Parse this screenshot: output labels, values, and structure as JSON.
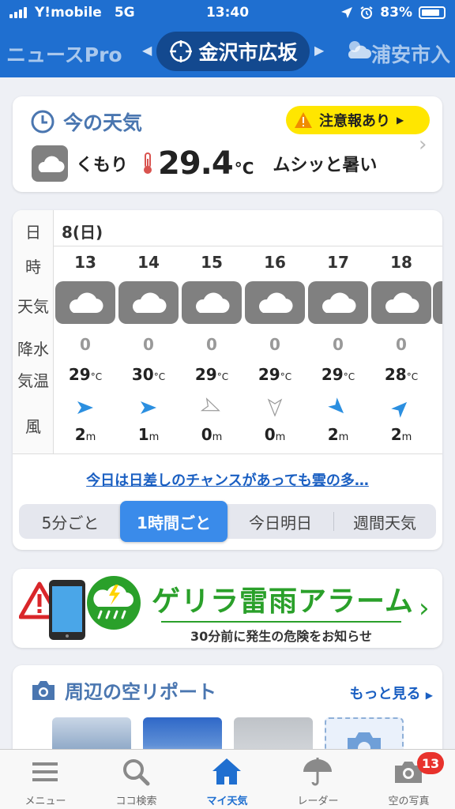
{
  "status_bar": {
    "carrier": "Y!mobile",
    "network": "5G",
    "time": "13:40",
    "battery": "83%"
  },
  "nav": {
    "prev_location": "ニュースPro",
    "current_location": "金沢市広坂",
    "next_location": "浦安市入"
  },
  "current_weather": {
    "title": "今の天気",
    "alert_badge": "注意報あり",
    "condition": "くもり",
    "temperature": "29.4",
    "temp_unit": "°C",
    "feels": "ムシッと暑い",
    "icon": "cloud-icon"
  },
  "hourly": {
    "labels": {
      "day": "日",
      "hour": "時",
      "weather": "天気",
      "rain": "降水",
      "temp": "気温",
      "wind": "風"
    },
    "day": "8(日)",
    "hours": [
      {
        "hour": "13",
        "rain": "0",
        "temp": "29",
        "temp_unit": "°C",
        "wind_speed": "2",
        "wind_unit": "m",
        "wind_dir": "east",
        "icon": "cloud-icon"
      },
      {
        "hour": "14",
        "rain": "0",
        "temp": "30",
        "temp_unit": "°C",
        "wind_speed": "1",
        "wind_unit": "m",
        "wind_dir": "east",
        "icon": "cloud-icon"
      },
      {
        "hour": "15",
        "rain": "0",
        "temp": "29",
        "temp_unit": "°C",
        "wind_speed": "0",
        "wind_unit": "m",
        "wind_dir": "east-southeast",
        "icon": "cloud-icon"
      },
      {
        "hour": "16",
        "rain": "0",
        "temp": "29",
        "temp_unit": "°C",
        "wind_speed": "0",
        "wind_unit": "m",
        "wind_dir": "south",
        "icon": "cloud-icon"
      },
      {
        "hour": "17",
        "rain": "0",
        "temp": "29",
        "temp_unit": "°C",
        "wind_speed": "2",
        "wind_unit": "m",
        "wind_dir": "south-east",
        "icon": "cloud-icon"
      },
      {
        "hour": "18",
        "rain": "0",
        "temp": "28",
        "temp_unit": "°C",
        "wind_speed": "2",
        "wind_unit": "m",
        "wind_dir": "north-east",
        "icon": "cloud-icon"
      }
    ],
    "news_link": "今日は日差しのチャンスがあっても雲の多…",
    "segments": [
      "5分ごと",
      "1時間ごと",
      "今日明日",
      "週間天気"
    ],
    "active_segment": "1時間ごと"
  },
  "alarm_banner": {
    "title": "ゲリラ雷雨アラーム",
    "subtitle": "30分前に発生の危険をお知らせ"
  },
  "sky_report": {
    "title": "周辺の空リポート",
    "more": "もっと見る"
  },
  "tabbar": {
    "items": [
      {
        "label": "メニュー",
        "icon": "menu-icon"
      },
      {
        "label": "ココ検索",
        "icon": "search-icon"
      },
      {
        "label": "マイ天気",
        "icon": "home-icon"
      },
      {
        "label": "レーダー",
        "icon": "umbrella-icon"
      },
      {
        "label": "空の写真",
        "icon": "camera-icon"
      }
    ],
    "active": "マイ天気",
    "photo_badge": "13"
  },
  "colors": {
    "header": "#1f6fd0",
    "accent_blue": "#1a5fc2",
    "alert_yellow": "#ffe600",
    "alarm_green": "#2aa02a",
    "wind_blue": "#2b8fe0"
  }
}
